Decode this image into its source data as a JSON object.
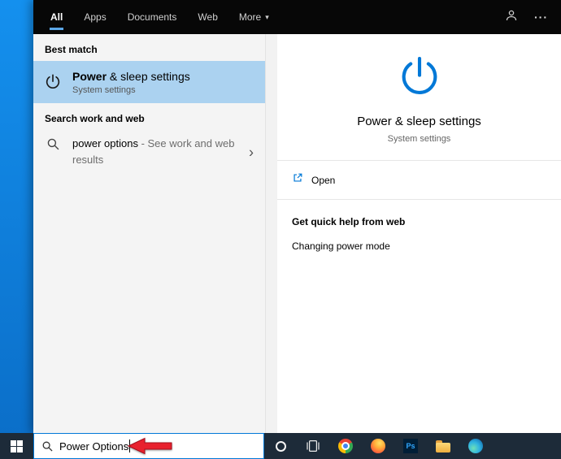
{
  "colors": {
    "accent_blue": "#0078d7",
    "selection_blue": "#abd2f0",
    "taskbar_bg": "#1d2b39",
    "desktop_blue": "#0f7cd8",
    "annotation_red": "#e8212e"
  },
  "topbar": {
    "active_tab": "All",
    "tabs": [
      {
        "label": "All"
      },
      {
        "label": "Apps"
      },
      {
        "label": "Documents"
      },
      {
        "label": "Web"
      },
      {
        "label": "More"
      }
    ]
  },
  "icons": {
    "ellipsis": "···",
    "chevron_down": "▾",
    "chevron_right": "›"
  },
  "left_panel": {
    "best_match_header": "Best match",
    "best_match": {
      "title_matched": "Power",
      "title_rest": " & sleep settings",
      "subtitle": "System settings"
    },
    "web_section_header": "Search work and web",
    "web_result": {
      "query": "power options",
      "description": " - See work and web results"
    }
  },
  "preview_panel": {
    "title": "Power & sleep settings",
    "subtitle": "System settings",
    "open_label": "Open",
    "help_header": "Get quick help from web",
    "help_link": "Changing power mode"
  },
  "taskbar": {
    "search_value": "Power Options",
    "photoshop_label": "Ps"
  }
}
